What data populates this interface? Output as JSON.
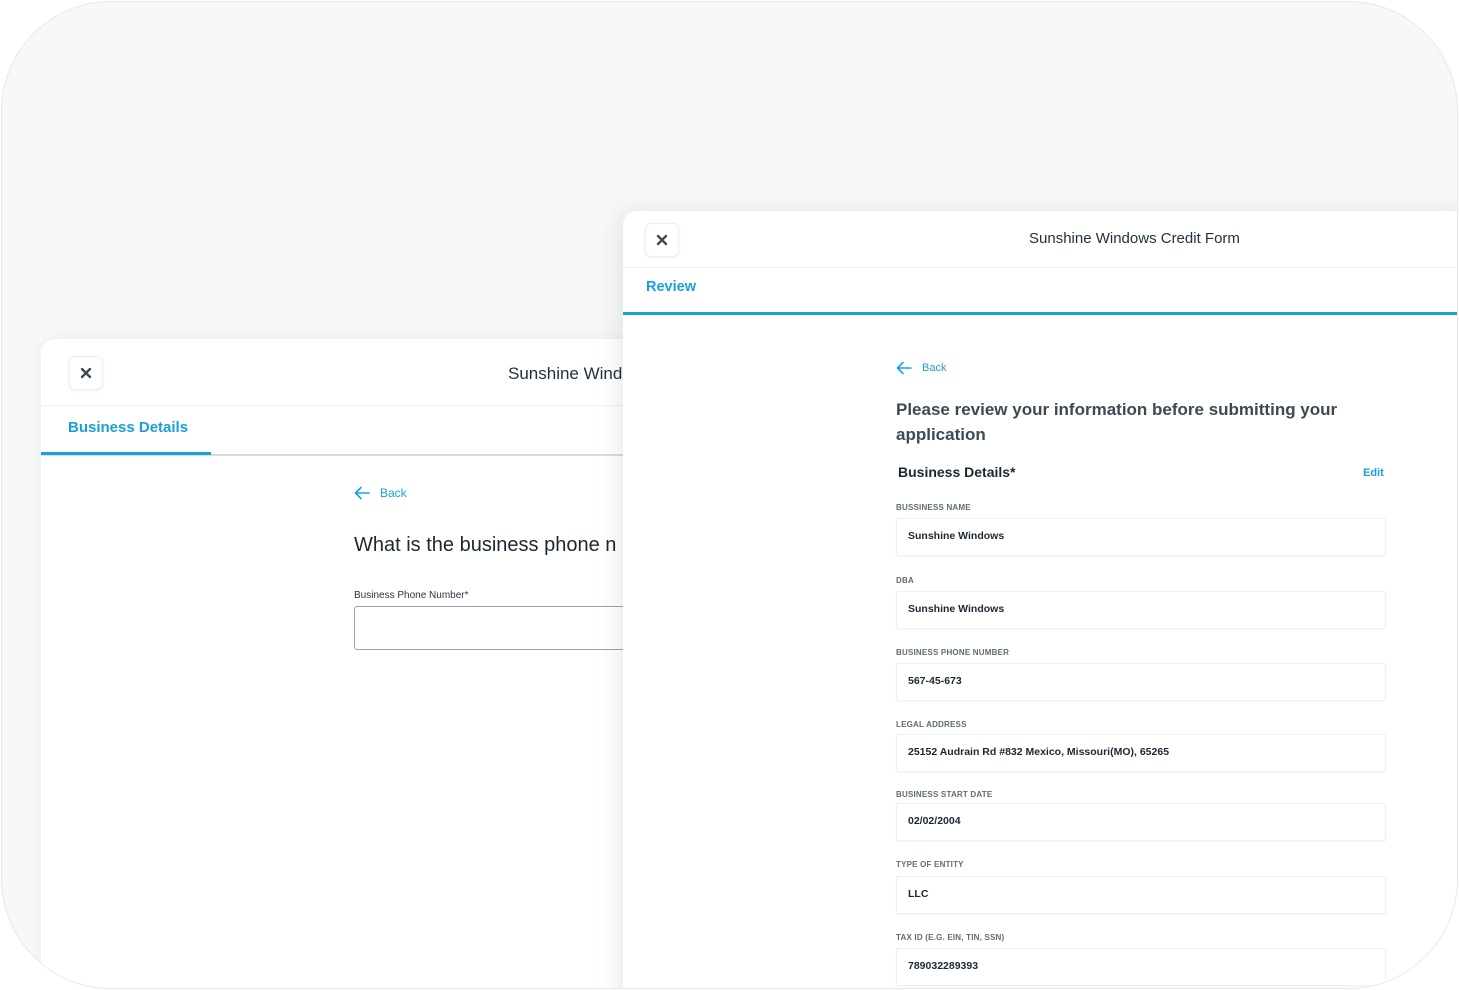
{
  "back_panel": {
    "title": "Sunshine Wind",
    "tab_label": "Business Details",
    "back_label": "Back",
    "question": "What is the business phone n",
    "phone_label": "Business Phone Number*",
    "phone_value": ""
  },
  "front_panel": {
    "title": "Sunshine Windows Credit Form",
    "tab_label": "Review",
    "back_label": "Back",
    "heading": "Please review your information before submitting your application",
    "section_title": "Business Details*",
    "edit_label": "Edit",
    "fields": [
      {
        "label": "BUSSINESS NAME",
        "value": "Sunshine Windows"
      },
      {
        "label": "DBA",
        "value": "Sunshine Windows"
      },
      {
        "label": "BUSINESS PHONE NUMBER",
        "value": "567-45-673"
      },
      {
        "label": "LEGAL ADDRESS",
        "value": "25152 Audrain Rd #832 Mexico, Missouri(MO), 65265"
      },
      {
        "label": "BUSINESS START DATE",
        "value": "02/02/2004"
      },
      {
        "label": "TYPE OF ENTITY",
        "value": "LLC"
      },
      {
        "label": "TAX ID (E.G. EIN, TIN, SSN)",
        "value": "789032289393"
      }
    ]
  },
  "colors": {
    "accent": "#1aa0d8",
    "text_dark": "#1b2833"
  },
  "icons": {
    "close": "close-icon",
    "back": "arrow-left-icon"
  }
}
